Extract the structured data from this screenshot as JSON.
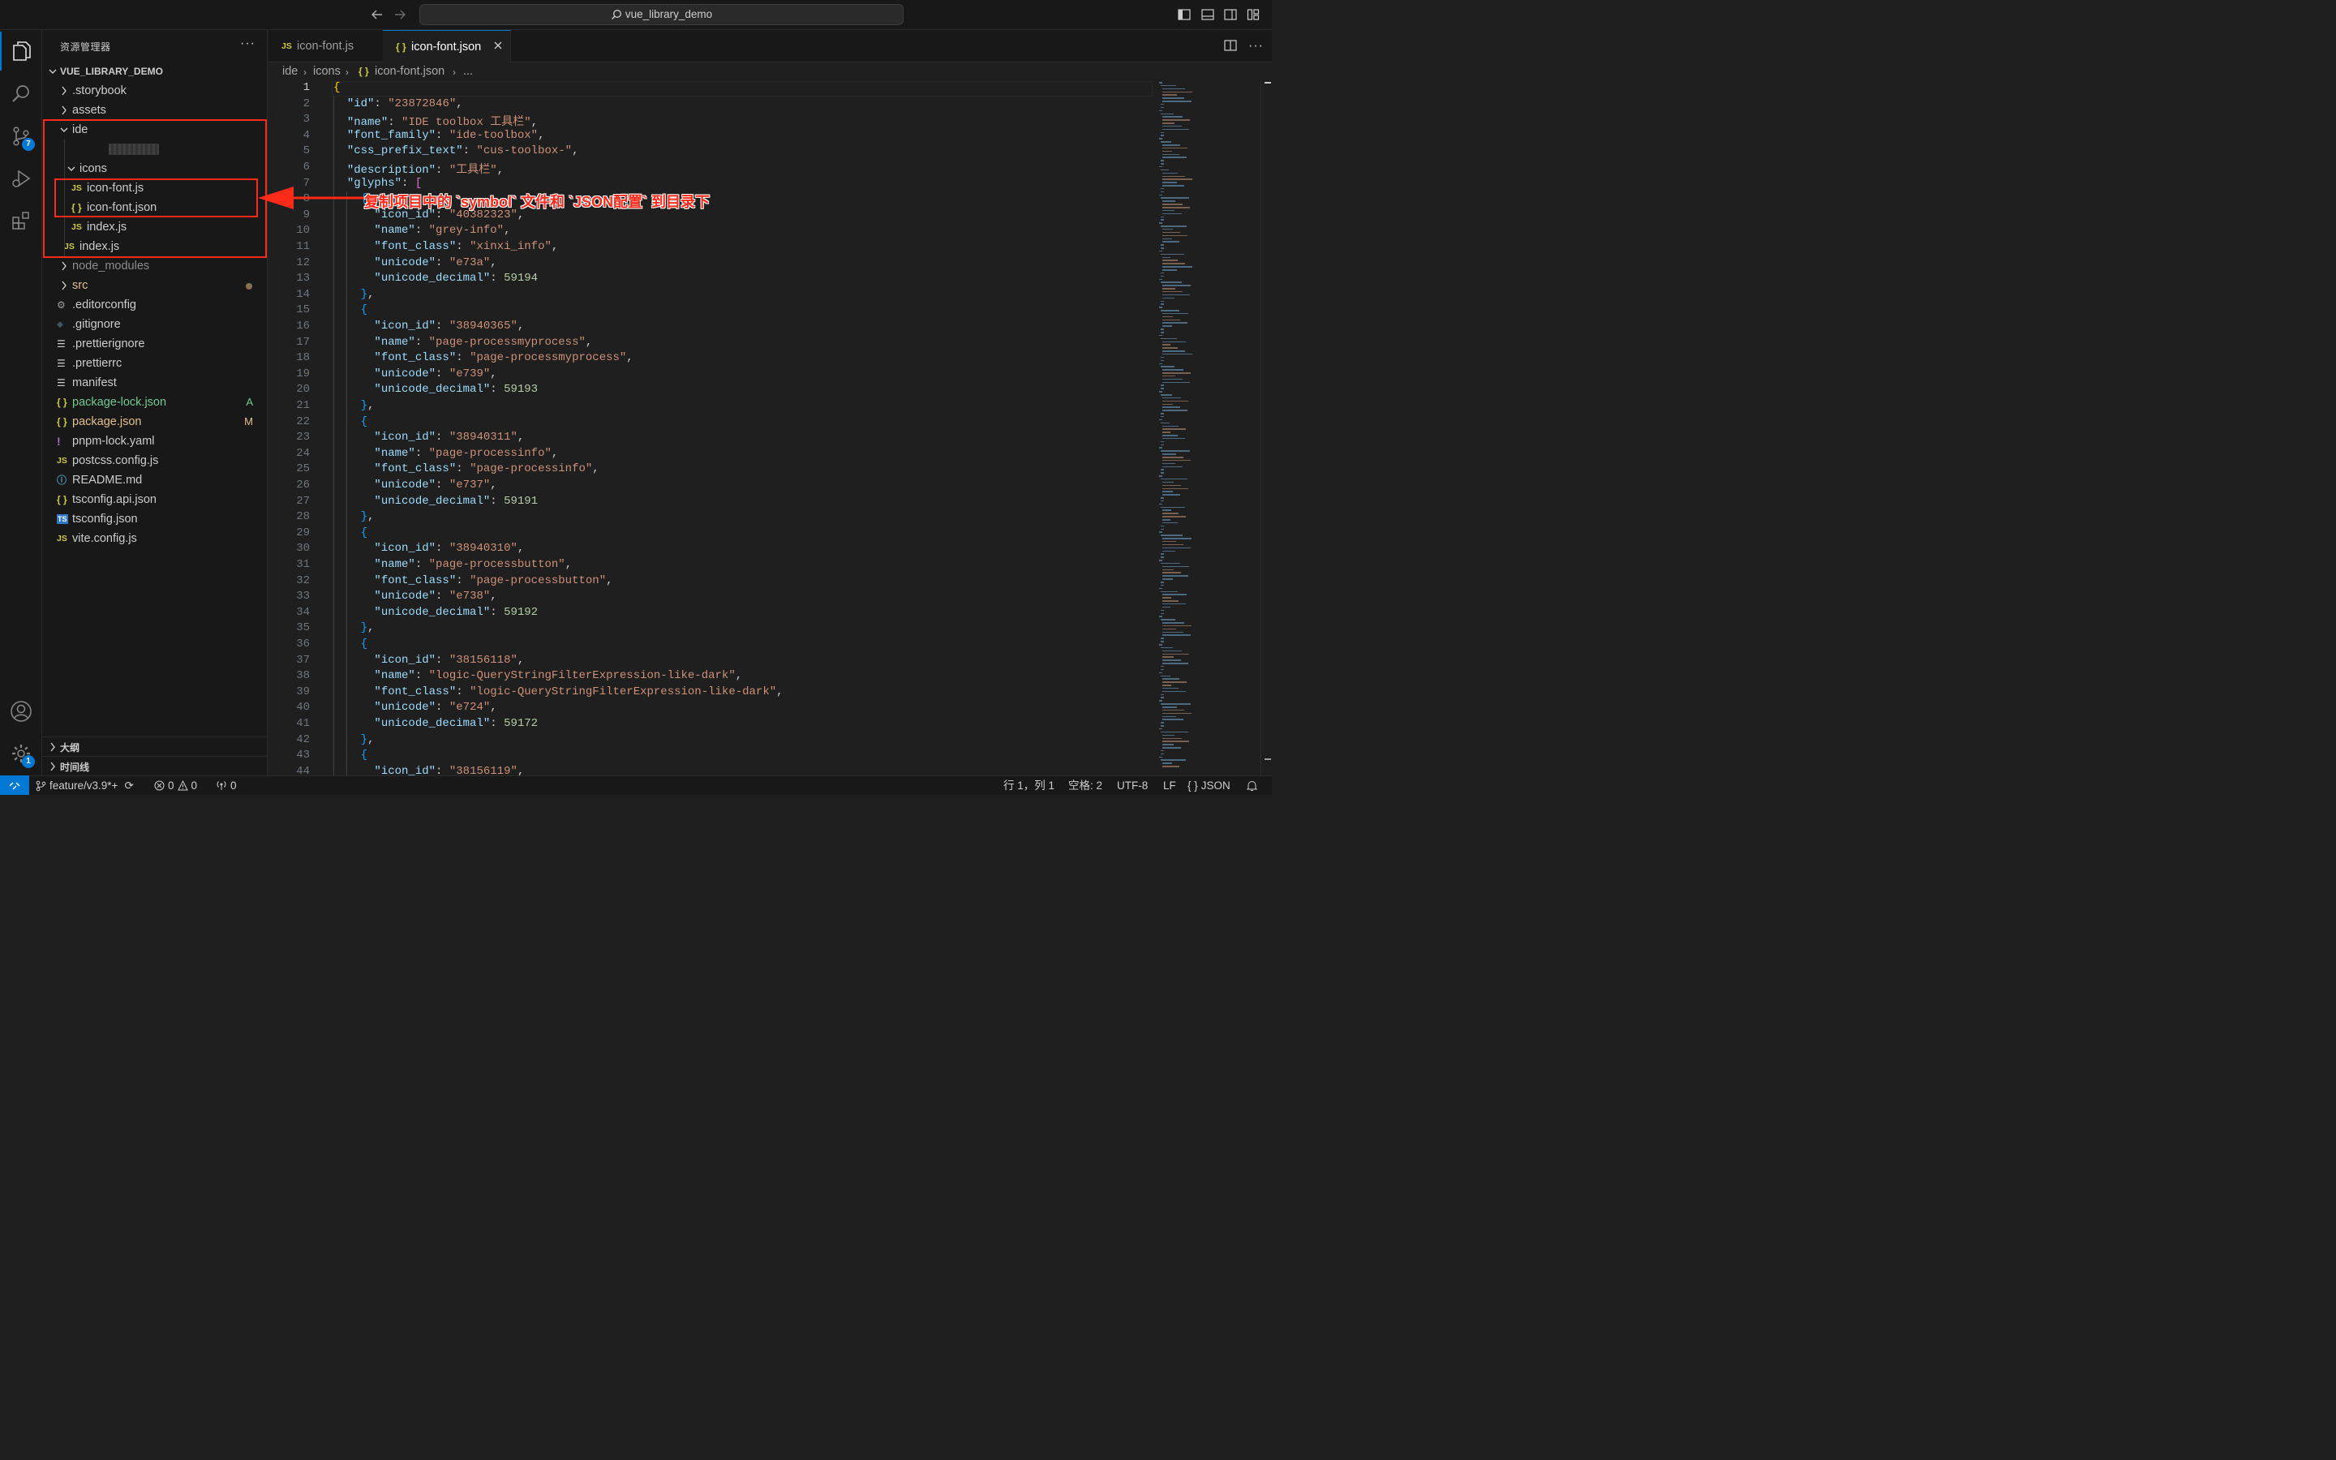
{
  "window": {
    "title": "vue_library_demo"
  },
  "activity_bar": {
    "source_control_badge": "7",
    "settings_badge": "1"
  },
  "sidebar": {
    "title": "资源管理器",
    "project": "VUE_LIBRARY_DEMO",
    "tree": [
      {
        "name": ".storybook",
        "type": "folder",
        "expanded": false
      },
      {
        "name": "assets",
        "type": "folder",
        "expanded": false
      },
      {
        "name": "ide",
        "type": "folder",
        "expanded": true
      },
      {
        "name": "",
        "type": "redacted"
      },
      {
        "name": "icons",
        "type": "folder",
        "expanded": true
      },
      {
        "name": "icon-font.js",
        "type": "js"
      },
      {
        "name": "icon-font.json",
        "type": "json"
      },
      {
        "name": "index.js",
        "type": "js"
      },
      {
        "name": "index.js",
        "type": "js"
      },
      {
        "name": "node_modules",
        "type": "folder",
        "expanded": false
      },
      {
        "name": "src",
        "type": "folder",
        "expanded": false
      },
      {
        "name": ".editorconfig",
        "type": "gear"
      },
      {
        "name": ".gitignore",
        "type": "git"
      },
      {
        "name": ".prettierignore",
        "type": "lines"
      },
      {
        "name": ".prettierrc",
        "type": "lines"
      },
      {
        "name": "manifest",
        "type": "lines"
      },
      {
        "name": "package-lock.json",
        "type": "json",
        "decoration": "A"
      },
      {
        "name": "package.json",
        "type": "json",
        "decoration": "M"
      },
      {
        "name": "pnpm-lock.yaml",
        "type": "yaml"
      },
      {
        "name": "postcss.config.js",
        "type": "js"
      },
      {
        "name": "README.md",
        "type": "info"
      },
      {
        "name": "tsconfig.api.json",
        "type": "json"
      },
      {
        "name": "tsconfig.json",
        "type": "ts"
      },
      {
        "name": "vite.config.js",
        "type": "js"
      }
    ],
    "outline_label": "大纲",
    "timeline_label": "时间线"
  },
  "tabs": [
    {
      "label": "icon-font.js",
      "icon": "JS",
      "active": false
    },
    {
      "label": "icon-font.json",
      "icon": "{ }",
      "active": true
    }
  ],
  "breadcrumb": [
    "ide",
    "icons",
    "icon-font.json",
    "..."
  ],
  "editor": {
    "current_line": 1,
    "code_lines": [
      "{",
      "  \"id\": \"23872846\",",
      "  \"name\": \"IDE toolbox 工具栏\",",
      "  \"font_family\": \"ide-toolbox\",",
      "  \"css_prefix_text\": \"cus-toolbox-\",",
      "  \"description\": \"工具栏\",",
      "  \"glyphs\": [",
      "    {",
      "      \"icon_id\": \"40382323\",",
      "      \"name\": \"grey-info\",",
      "      \"font_class\": \"xinxi_info\",",
      "      \"unicode\": \"e73a\",",
      "      \"unicode_decimal\": 59194",
      "    },",
      "    {",
      "      \"icon_id\": \"38940365\",",
      "      \"name\": \"page-processmyprocess\",",
      "      \"font_class\": \"page-processmyprocess\",",
      "      \"unicode\": \"e739\",",
      "      \"unicode_decimal\": 59193",
      "    },",
      "    {",
      "      \"icon_id\": \"38940311\",",
      "      \"name\": \"page-processinfo\",",
      "      \"font_class\": \"page-processinfo\",",
      "      \"unicode\": \"e737\",",
      "      \"unicode_decimal\": 59191",
      "    },",
      "    {",
      "      \"icon_id\": \"38940310\",",
      "      \"name\": \"page-processbutton\",",
      "      \"font_class\": \"page-processbutton\",",
      "      \"unicode\": \"e738\",",
      "      \"unicode_decimal\": 59192",
      "    },",
      "    {",
      "      \"icon_id\": \"38156118\",",
      "      \"name\": \"logic-QueryStringFilterExpression-like-dark\",",
      "      \"font_class\": \"logic-QueryStringFilterExpression-like-dark\",",
      "      \"unicode\": \"e724\",",
      "      \"unicode_decimal\": 59172",
      "    },",
      "    {",
      "      \"icon_id\": \"38156119\","
    ]
  },
  "annotation": {
    "text": "复制项目中的 `symbol` 文件和 `JSON配置` 到目录下"
  },
  "status_bar": {
    "branch": "feature/v3.9*+",
    "errors": "0",
    "warnings": "0",
    "ports": "0",
    "cursor_position": "行 1，列 1",
    "indent": "空格: 2",
    "encoding": "UTF-8",
    "eol": "LF",
    "language": "JSON"
  },
  "colors": {
    "accent": "#0078d4",
    "annotation": "#ff2a1a",
    "js_icon": "#cbcb41",
    "json_icon": "#cbcb41"
  }
}
